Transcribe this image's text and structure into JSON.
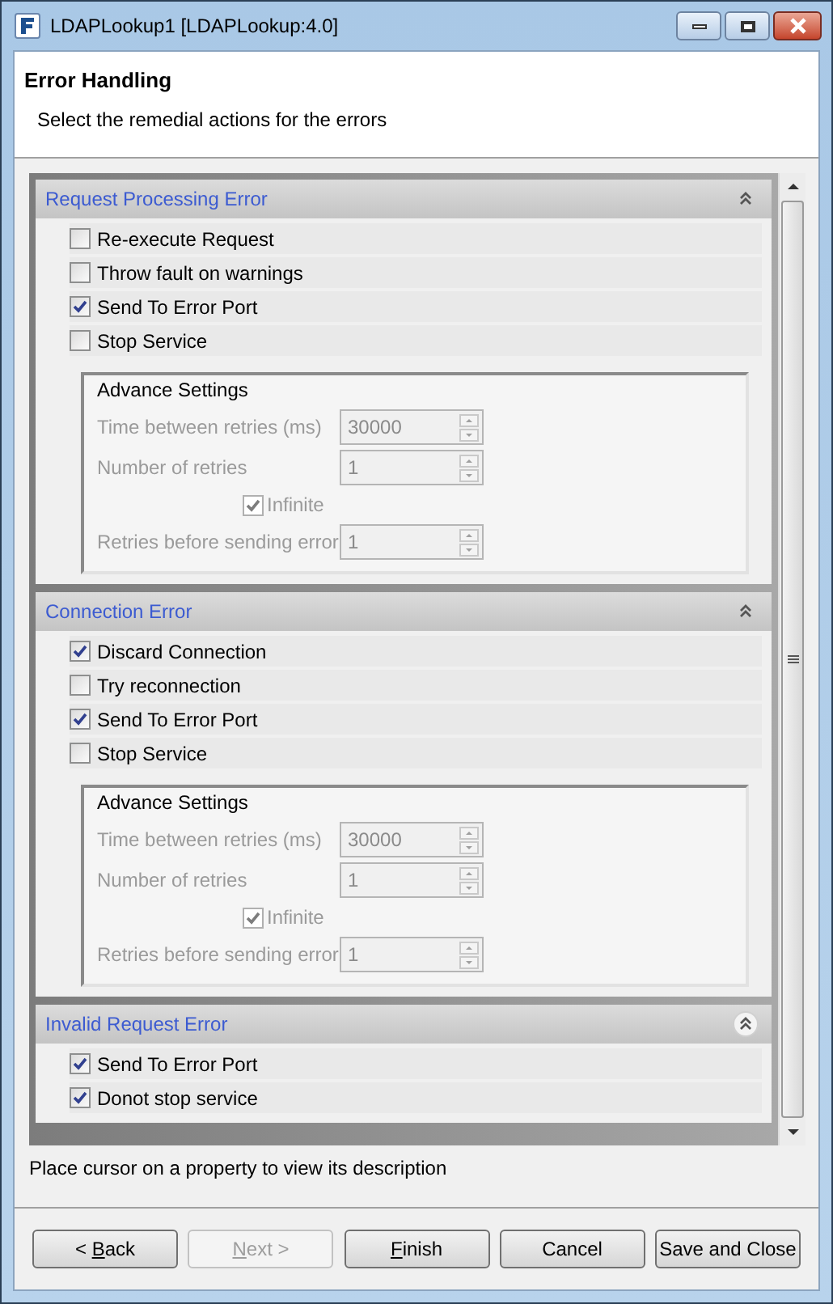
{
  "window": {
    "title": "LDAPLookup1 [LDAPLookup:4.0]"
  },
  "header": {
    "title": "Error Handling",
    "subtitle": "Select the remedial actions for the errors"
  },
  "sections": [
    {
      "title": "Request Processing Error",
      "toggle_highlighted": false,
      "options": [
        {
          "label": "Re-execute Request",
          "checked": false
        },
        {
          "label": "Throw fault on warnings",
          "checked": false
        },
        {
          "label": "Send To Error Port",
          "checked": true
        },
        {
          "label": "Stop Service",
          "checked": false
        }
      ],
      "advance_settings": {
        "title": "Advance Settings",
        "disabled": true,
        "time_label": "Time between retries (ms)",
        "time_value": "30000",
        "retries_label": "Number of retries",
        "retries_value": "1",
        "infinite_label": "Infinite",
        "infinite_checked": true,
        "before_error_label": "Retries before sending error",
        "before_error_value": "1"
      }
    },
    {
      "title": "Connection Error",
      "toggle_highlighted": false,
      "options": [
        {
          "label": "Discard Connection",
          "checked": true
        },
        {
          "label": "Try reconnection",
          "checked": false
        },
        {
          "label": "Send To Error Port",
          "checked": true
        },
        {
          "label": "Stop Service",
          "checked": false
        }
      ],
      "advance_settings": {
        "title": "Advance Settings",
        "disabled": true,
        "time_label": "Time between retries (ms)",
        "time_value": "30000",
        "retries_label": "Number of retries",
        "retries_value": "1",
        "infinite_label": "Infinite",
        "infinite_checked": true,
        "before_error_label": "Retries before sending error",
        "before_error_value": "1"
      }
    },
    {
      "title": "Invalid Request Error",
      "toggle_highlighted": true,
      "options": [
        {
          "label": "Send To Error Port",
          "checked": true
        },
        {
          "label": "Donot stop service",
          "checked": true
        }
      ]
    }
  ],
  "description": "Place cursor on a property to view its description",
  "buttons": [
    {
      "before": "< ",
      "key": "B",
      "after": "ack",
      "disabled": false
    },
    {
      "key": "N",
      "after": "ext >",
      "disabled": true
    },
    {
      "key": "F",
      "after": "inish",
      "disabled": false
    },
    {
      "label": "Cancel",
      "disabled": false
    },
    {
      "label": "Save and Close",
      "disabled": false
    }
  ]
}
